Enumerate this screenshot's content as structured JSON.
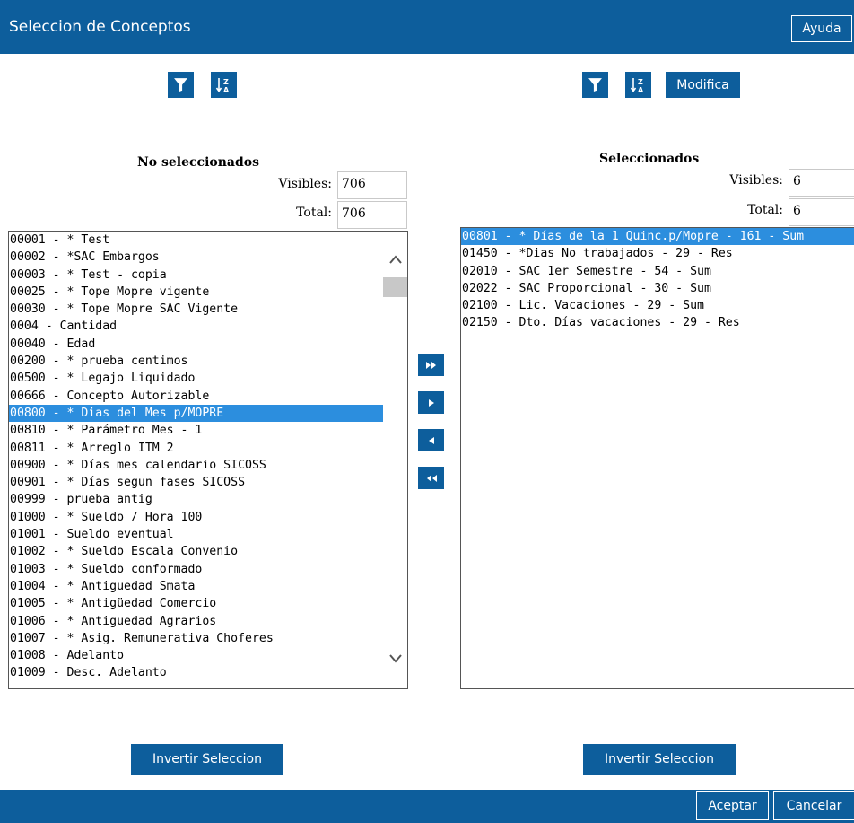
{
  "window": {
    "title": "Seleccion de Conceptos",
    "help_label": "Ayuda"
  },
  "toolbar": {
    "modify_label": "Modifica"
  },
  "left": {
    "heading": "No seleccionados",
    "visible_label": "Visibles:",
    "visible_value": "706",
    "total_label": "Total:",
    "total_value": "706",
    "items": [
      "00001 - * Test",
      "00002 - *SAC Embargos",
      "00003 - * Test - copia",
      "00025 - * Tope Mopre vigente",
      "00030 - * Tope Mopre SAC Vigente",
      "0004 - Cantidad",
      "00040 - Edad",
      "00200 - * prueba centimos",
      "00500 - * Legajo Liquidado",
      "00666 - Concepto Autorizable",
      "00800 - * Dias del Mes p/MOPRE",
      "00810 - * Parámetro Mes - 1",
      "00811 - * Arreglo ITM 2",
      "00900 - * Días mes calendario SICOSS",
      "00901 - * Días segun fases SICOSS",
      "00999 - prueba antig",
      "01000 - * Sueldo / Hora 100",
      "01001 - Sueldo eventual",
      "01002 - * Sueldo Escala Convenio",
      "01003 - * Sueldo conformado",
      "01004 - * Antiguedad Smata",
      "01005 - * Antigüedad Comercio",
      "01006 - * Antiguedad Agrarios",
      "01007 - * Asig. Remunerativa Choferes",
      "01008 - Adelanto",
      "01009 - Desc. Adelanto"
    ],
    "selected_item": "00800 - * Dias del Mes p/MOPRE",
    "invert_label": "Invertir Seleccion"
  },
  "right": {
    "heading": "Seleccionados",
    "visible_label": "Visibles:",
    "visible_value": "6",
    "total_label": "Total:",
    "total_value": "6",
    "items": [
      "00801 - * Días de la 1 Quinc.p/Mopre - 161 - Sum",
      "01450 - *Dias No trabajados - 29 - Res",
      "02010 - SAC 1er Semestre - 54 - Sum",
      "02022 - SAC Proporcional - 30 - Sum",
      "02100 - Lic. Vacaciones - 29 - Sum",
      "02150 - Dto. Días vacaciones - 29 - Res"
    ],
    "selected_item": "00801 - * Días de la 1 Quinc.p/Mopre - 161 - Sum",
    "invert_label": "Invertir Seleccion"
  },
  "footer": {
    "accept_label": "Aceptar",
    "cancel_label": "Cancelar"
  },
  "icons": {
    "filter": "filter-icon",
    "sort": "sort-az-icon",
    "move_all_right": "double-chevron-right-icon",
    "move_right": "triangle-right-icon",
    "move_left": "triangle-left-icon",
    "move_all_left": "double-chevron-left-icon"
  },
  "colors": {
    "brand": "#0d5e9c",
    "selection": "#2c8ede"
  }
}
